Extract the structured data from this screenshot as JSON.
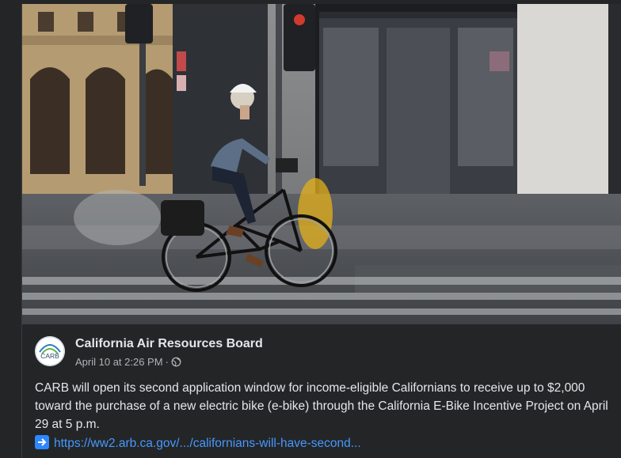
{
  "post": {
    "page_name": "California Air Resources Board",
    "timestamp": "April 10 at 2:26 PM",
    "separator": "·",
    "audience_icon": "globe-icon",
    "avatar_text": "CARB",
    "body": "CARB will open its second application window for income-eligible Californians to receive up to $2,000 toward the purchase of a new electric bike (e-bike) through the California E-Bike Incentive Project on April 29 at 5 p.m.",
    "link_icon": "arrow-right-icon",
    "link_text": "https://ww2.arb.ca.gov/.../californians-will-have-second..."
  },
  "photo": {
    "subject": "cyclist-on-electric-bike-photo"
  },
  "colors": {
    "background": "#242526",
    "text_primary": "#e4e6eb",
    "text_secondary": "#b0b3b8",
    "link": "#4599ff",
    "accent": "#2d88ff"
  }
}
